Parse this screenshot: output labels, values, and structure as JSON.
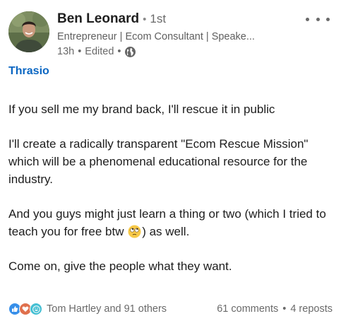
{
  "author": {
    "name": "Ben Leonard",
    "connection_degree": "1st",
    "headline": "Entrepreneur | Ecom Consultant | Speake...",
    "time_ago": "13h",
    "edited_label": "Edited",
    "visibility_icon": "globe-icon",
    "separator": "•"
  },
  "company_tag": "Thrasio",
  "post": {
    "paragraphs": [
      "If you sell me my brand back, I'll rescue it in public",
      "I'll create a radically transparent \"Ecom Rescue Mission\" which will be a phenomenal educational resource for the industry.",
      "Come on, give the people what they want."
    ],
    "paragraph_3_before_emoji": "And you guys might just learn a thing or two (which I tried to teach you for free btw",
    "paragraph_3_after_emoji": ") as well.",
    "emoji": "rolling-eyes-emoji"
  },
  "social": {
    "reaction_icons": [
      "like-icon",
      "love-icon",
      "funny-icon"
    ],
    "reactors_text": "Tom Hartley and 91 others",
    "comments_text": "61 comments",
    "reposts_text": "4 reposts",
    "separator": "•"
  },
  "colors": {
    "link_blue": "#0a66c2",
    "like_blue": "#378fe9",
    "love_red": "#df704d",
    "funny_teal": "#44bfd3"
  }
}
